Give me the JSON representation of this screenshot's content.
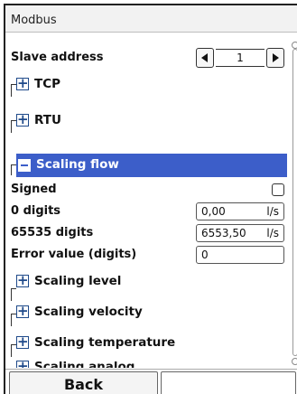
{
  "title": "Modbus",
  "slave": {
    "label": "Slave address",
    "value": "1"
  },
  "groups": {
    "tcp": "TCP",
    "rtu": "RTU",
    "scaling_flow": "Scaling flow",
    "scaling_level": "Scaling level",
    "scaling_velocity": "Scaling velocity",
    "scaling_temperature": "Scaling temperature",
    "scaling_analog": "Scaling analog"
  },
  "flow": {
    "signed_label": "Signed",
    "signed_checked": false,
    "zero_label": "0 digits",
    "zero_value": "0,00",
    "zero_unit": "l/s",
    "max_label": "65535 digits",
    "max_value": "6553,50",
    "max_unit": "l/s",
    "error_label": "Error value (digits)",
    "error_value": "0"
  },
  "footer": {
    "back_label": "Back",
    "right_label": ""
  },
  "colors": {
    "accent": "#3c5ec9",
    "icon_blue": "#1f4a8a"
  },
  "icons": {
    "expand": "plus-icon",
    "collapse": "minus-icon",
    "prev": "arrow-left-icon",
    "next": "arrow-right-icon"
  }
}
